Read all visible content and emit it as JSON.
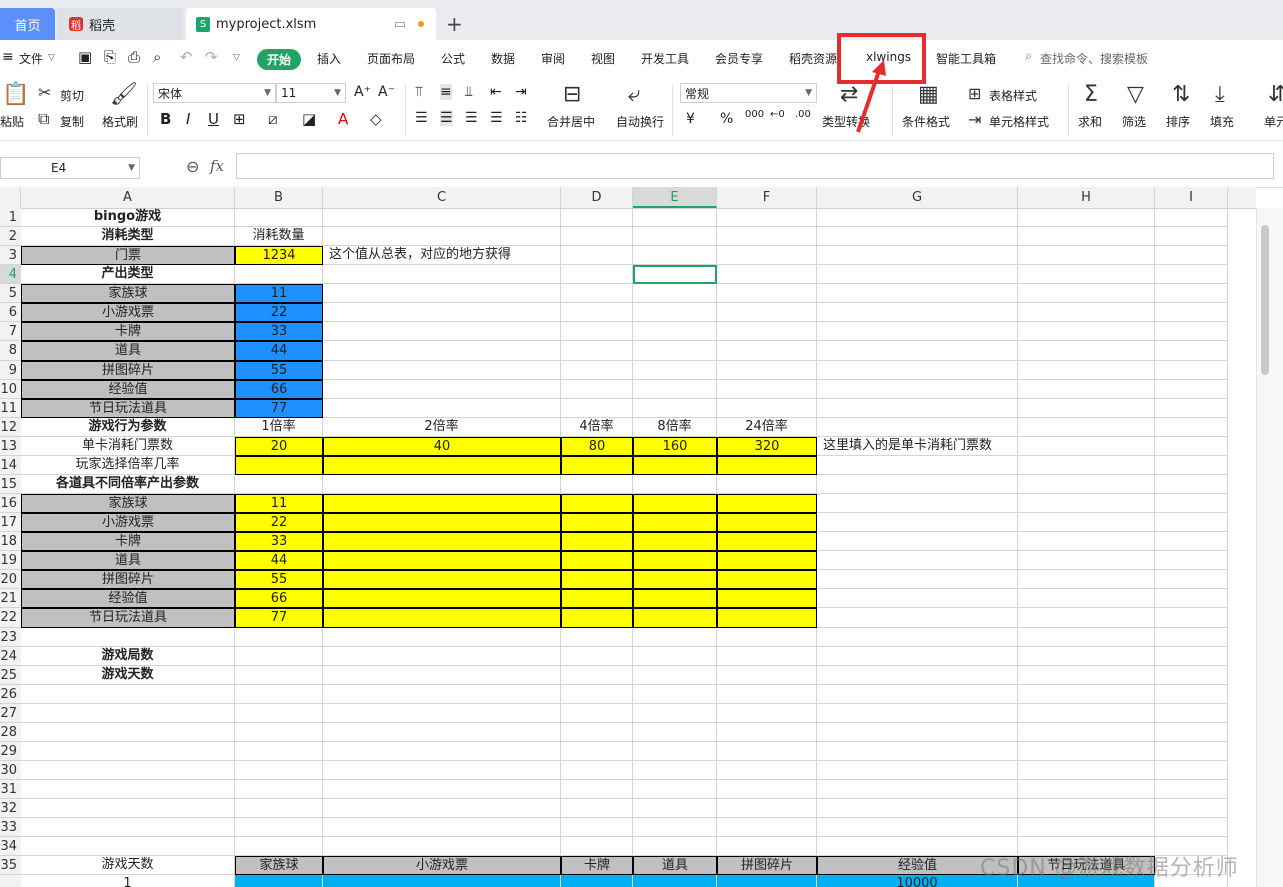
{
  "tabs": {
    "home": "首页",
    "docer": "稻壳",
    "file": "myproject.xlsm"
  },
  "menu": [
    "文件",
    "开始",
    "插入",
    "页面布局",
    "公式",
    "数据",
    "审阅",
    "视图",
    "开发工具",
    "会员专享",
    "稻壳资源",
    "xlwings",
    "智能工具箱"
  ],
  "search_placeholder": "查找命令、搜索模板",
  "ribbon": {
    "paste": "粘贴",
    "cut": "剪切",
    "copy": "复制",
    "format_painter": "格式刷",
    "font": "宋体",
    "font_size": "11",
    "merge_center": "合并居中",
    "wrap": "自动换行",
    "number_format": "常规",
    "type_convert": "类型转换",
    "cond_format": "条件格式",
    "table_style": "表格样式",
    "cell_style": "单元格样式",
    "sum": "求和",
    "filter": "筛选",
    "sort": "排序",
    "fill": "填充",
    "cell": "单元"
  },
  "formula_bar": {
    "name_box": "E4",
    "fx": "fx"
  },
  "columns": [
    "A",
    "B",
    "C",
    "D",
    "E",
    "F",
    "G",
    "H",
    "I"
  ],
  "rows": [
    "1",
    "2",
    "3",
    "4",
    "5",
    "6",
    "7",
    "8",
    "9",
    "10",
    "11",
    "12",
    "13",
    "14",
    "15",
    "16",
    "17",
    "18",
    "19",
    "20",
    "21",
    "22",
    "23",
    "24",
    "25",
    "26",
    "27",
    "28",
    "29",
    "30",
    "31",
    "32",
    "33",
    "34",
    "35"
  ],
  "cells": {
    "A1": "bingo游戏",
    "A2": "消耗类型",
    "B2": "消耗数量",
    "A3": "门票",
    "B3": "1234",
    "C3": "这个值从总表，对应的地方获得",
    "A4": "产出类型",
    "A5": "家族球",
    "B5": "11",
    "A6": "小游戏票",
    "B6": "22",
    "A7": "卡牌",
    "B7": "33",
    "A8": "道具",
    "B8": "44",
    "A9": "拼图碎片",
    "B9": "55",
    "A10": "经验值",
    "B10": "66",
    "A11": "节日玩法道具",
    "B11": "77",
    "A12": "游戏行为参数",
    "B12": "1倍率",
    "C12": "2倍率",
    "D12": "4倍率",
    "E12": "8倍率",
    "F12": "24倍率",
    "A13": "单卡消耗门票数",
    "B13": "20",
    "C13": "40",
    "D13": "80",
    "E13": "160",
    "F13": "320",
    "G13": "这里填入的是单卡消耗门票数",
    "A14": "玩家选择倍率几率",
    "A15": "各道具不同倍率产出参数",
    "A16": "家族球",
    "B16": "11",
    "A17": "小游戏票",
    "B17": "22",
    "A18": "卡牌",
    "B18": "33",
    "A19": "道具",
    "B19": "44",
    "A20": "拼图碎片",
    "B20": "55",
    "A21": "经验值",
    "B21": "66",
    "A22": "节日玩法道具",
    "B22": "77",
    "A24": "游戏局数",
    "A25": "游戏天数",
    "A35": "游戏天数",
    "B35": "家族球",
    "C35": "小游戏票",
    "D35": "卡牌",
    "E35": "道具",
    "F35": "拼图碎片",
    "G35": "经验值",
    "H35": "节日玩法道具",
    "A36": "1",
    "G36": "10000"
  },
  "watermark": "CSDN @游戏数据分析师",
  "colors": {
    "accent": "#21a366",
    "highlight_box": "#e52d2d",
    "yellow": "#ffff00",
    "blue": "#1e90ff",
    "gray": "#c0c0c0"
  }
}
